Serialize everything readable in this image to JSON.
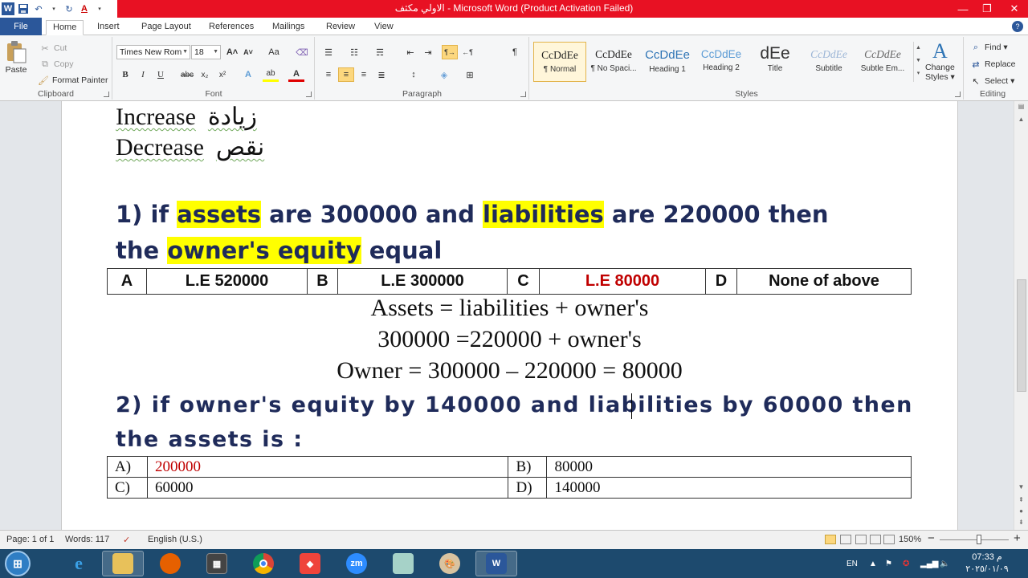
{
  "window": {
    "title": "الاولي مكثف  -  Microsoft Word (Product Activation Failed)",
    "controls": {
      "minimize": "—",
      "restore": "❐",
      "close": "✕"
    }
  },
  "quick_access": {
    "word": "W",
    "save": "💾",
    "undo": "↶",
    "redo": "↻",
    "font_color": "A",
    "more": "▾"
  },
  "tabs": [
    "File",
    "Home",
    "Insert",
    "Page Layout",
    "References",
    "Mailings",
    "Review",
    "View"
  ],
  "active_tab": "Home",
  "help": "?",
  "ribbon": {
    "clipboard": {
      "label": "Clipboard",
      "paste": "Paste",
      "cut": "Cut",
      "copy": "Copy",
      "format_painter": "Format Painter"
    },
    "font": {
      "label": "Font",
      "font_name": "Times New Rom",
      "font_size": "18",
      "grow": "A˄",
      "shrink": "A˅",
      "change_case": "Aa",
      "clear": "🅐",
      "bold": "B",
      "italic": "I",
      "underline": "U",
      "strike": "abc",
      "sub": "x₂",
      "sup": "x²",
      "effects": "A",
      "highlight": "ab",
      "color": "A"
    },
    "paragraph": {
      "label": "Paragraph",
      "pilcrow": "¶"
    },
    "styles": {
      "label": "Styles",
      "items": [
        {
          "sample": "CcDdEe",
          "name": "¶ Normal"
        },
        {
          "sample": "CcDdEe",
          "name": "¶ No Spaci..."
        },
        {
          "sample": "CcDdEe",
          "name": "Heading 1"
        },
        {
          "sample": "CcDdEe",
          "name": "Heading 2"
        },
        {
          "sample": "dEe",
          "name": "Title"
        },
        {
          "sample": "CcDdEe",
          "name": "Subtitle"
        },
        {
          "sample": "CcDdEe",
          "name": "Subtle Em..."
        }
      ],
      "change_styles_line1": "Change",
      "change_styles_line2": "Styles ▾"
    },
    "editing": {
      "label": "Editing",
      "find": "Find ▾",
      "replace": "Replace",
      "select": "Select ▾"
    }
  },
  "document": {
    "vocab": [
      {
        "en": "Increase",
        "ar": "زيادة"
      },
      {
        "en": "Decrease",
        "ar": "نقص"
      }
    ],
    "q1": {
      "line1": {
        "a": "1) if ",
        "b": "assets",
        "c": " are 300000 and ",
        "d": "liabilities",
        "e": " are 220000 then"
      },
      "line2": {
        "a": "the ",
        "b": "owner's equity",
        "c": " equal"
      },
      "options": [
        {
          "letter": "A",
          "text": "L.E 520000"
        },
        {
          "letter": "B",
          "text": "L.E 300000"
        },
        {
          "letter": "C",
          "text": "L.E 80000"
        },
        {
          "letter": "D",
          "text": "None of above"
        }
      ],
      "correct": "C",
      "work": [
        "Assets = liabilities + owner's",
        "300000 =220000 + owner's",
        "Owner = 300000 – 220000 = 80000"
      ]
    },
    "q2": {
      "line1": "2) if owner's equity by 140000 and liabilities  by 60000 then",
      "line2": "the assets is :",
      "options": [
        {
          "letter": "A)",
          "text": "200000"
        },
        {
          "letter": "B)",
          "text": "80000"
        },
        {
          "letter": "C)",
          "text": "60000"
        },
        {
          "letter": "D)",
          "text": "140000"
        }
      ],
      "correct": "A)"
    }
  },
  "statusbar": {
    "page": "Page: 1 of 1",
    "words": "Words: 117",
    "language": "English (U.S.)",
    "zoom": "150%",
    "zoom_out": "−",
    "zoom_in": "+"
  },
  "taskbar": {
    "apps": [
      "Internet Explorer",
      "File Explorer",
      "Firefox",
      "Calculator",
      "Chrome",
      "AnyDesk",
      "Zoom",
      "Notes",
      "Paint",
      "Word"
    ],
    "lang": "EN",
    "time": "07:33 م",
    "date": "٢٠٢٥/٠١/٠٩"
  },
  "colors": {
    "title_bar": "#e81123",
    "file_tab": "#2b579a",
    "highlight": "#ffff00",
    "question_text": "#1f2b5a",
    "answer_red": "#c00000",
    "taskbar": "#1d4a6e"
  }
}
